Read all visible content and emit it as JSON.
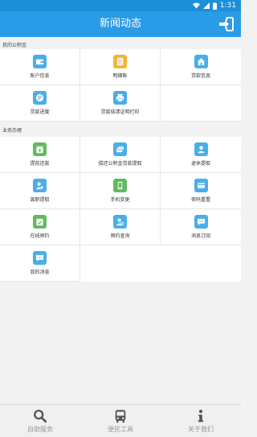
{
  "statusbar": {
    "time": "1:31"
  },
  "header": {
    "title": "新闻动态"
  },
  "sections": [
    {
      "label": "我的公积金",
      "items": [
        {
          "label": "账户信息",
          "icon": "wallet-icon",
          "color": "blue"
        },
        {
          "label": "明细账",
          "icon": "ledger-icon",
          "color": "yellow"
        },
        {
          "label": "贷款信息",
          "icon": "house-icon",
          "color": "blue"
        },
        {
          "label": "贷款进度",
          "icon": "progress-icon",
          "color": "blue"
        },
        {
          "label": "贷款结清证明打印",
          "icon": "printer-icon",
          "color": "blue"
        }
      ]
    },
    {
      "label": "业务办理",
      "items": [
        {
          "label": "提前还款",
          "icon": "calendar-icon",
          "color": "green"
        },
        {
          "label": "偿还公积金贷款提取",
          "icon": "card-stack-icon",
          "color": "blue"
        },
        {
          "label": "退休提取",
          "icon": "person-icon",
          "color": "blue"
        },
        {
          "label": "离职提取",
          "icon": "person-badge-icon",
          "color": "blue"
        },
        {
          "label": "手机变更",
          "icon": "phone-icon",
          "color": "green"
        },
        {
          "label": "密码重置",
          "icon": "card-icon",
          "color": "blue"
        },
        {
          "label": "在线预约",
          "icon": "calendar-check-icon",
          "color": "green"
        },
        {
          "label": "预约查询",
          "icon": "person-search-icon",
          "color": "blue"
        },
        {
          "label": "消息订阅",
          "icon": "message-icon",
          "color": "blue"
        },
        {
          "label": "我的消息",
          "icon": "chat-icon",
          "color": "blue"
        }
      ]
    }
  ],
  "bottom_tabs": [
    {
      "label": "自助服务",
      "icon": "search-icon"
    },
    {
      "label": "便民工具",
      "icon": "bus-icon"
    },
    {
      "label": "关于我们",
      "icon": "info-icon"
    }
  ],
  "colors": {
    "statusbar": "#1d8fd8",
    "appbar": "#2a9be6",
    "blue_icon": "#4aaee8",
    "yellow_icon": "#f5b534",
    "green_icon": "#62b962"
  }
}
